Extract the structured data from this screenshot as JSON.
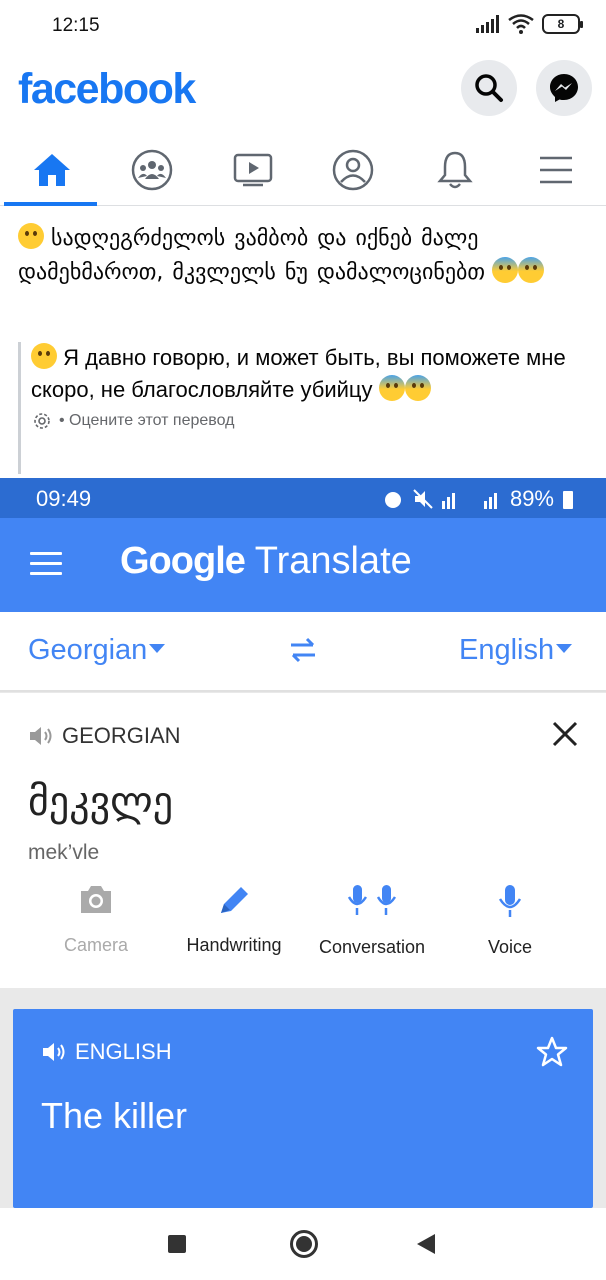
{
  "status_bar": {
    "time": "12:15",
    "battery": "8"
  },
  "header": {
    "logo": "facebook",
    "search_icon": "search-icon",
    "messenger_icon": "messenger-icon"
  },
  "nav": {
    "tabs": [
      {
        "name": "home",
        "icon": "home-icon",
        "active": true
      },
      {
        "name": "groups",
        "icon": "groups-icon"
      },
      {
        "name": "watch",
        "icon": "video-icon"
      },
      {
        "name": "profile",
        "icon": "profile-icon"
      },
      {
        "name": "notifications",
        "icon": "bell-icon"
      },
      {
        "name": "menu",
        "icon": "hamburger-icon"
      }
    ],
    "accent": "#1877f2"
  },
  "post": {
    "text": "სადღეგრძელოს ვამბობ და იქნებ მალე დამეხმაროთ, მკვლელს ნუ დამალოცინებთ",
    "translation": "Я давно говорю, и может быть, вы поможете мне скоро, не благословляйте убийцу",
    "rate_text": "• Оцените этот перевод"
  },
  "google_translate": {
    "status_time": "09:49",
    "status_battery": "89%",
    "app_title_google": "Google",
    "app_title_translate": "Translate",
    "source_lang": "Georgian",
    "target_lang": "English",
    "source_label": "GEORGIAN",
    "source_text": "მეკვლე",
    "source_translit": "mek’vle",
    "tools": [
      "Camera",
      "Handwriting",
      "Conversation",
      "Voice"
    ],
    "output_label": "ENGLISH",
    "output_text": "The killer",
    "accent": "#4285f4"
  }
}
